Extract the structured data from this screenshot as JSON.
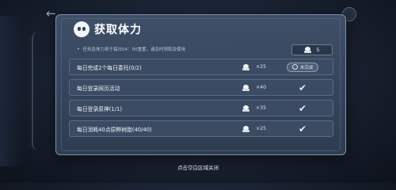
{
  "dialog": {
    "title": "获取体力",
    "notice": "任务及体力将于每日04：00重置，请及时领取及使用",
    "stamina_value": "5"
  },
  "tasks": [
    {
      "label": "每日完成2个每日委托(0/2)",
      "reward": "×25",
      "status": "pending",
      "status_text": "未完成"
    },
    {
      "label": "每日登录网页活动",
      "reward": "×40",
      "status": "done",
      "status_text": ""
    },
    {
      "label": "每日登录原神(1/1)",
      "reward": "×35",
      "status": "done",
      "status_text": ""
    },
    {
      "label": "每日消耗40点原粹树脂(40/40)",
      "reward": "×25",
      "status": "done",
      "status_text": ""
    }
  ],
  "footer": {
    "hint": "点击空白区域关闭"
  },
  "icons": {
    "title": "paimon-icon",
    "stamina": "stamina-icon",
    "done": "checkmark-icon",
    "pending": "clock-icon",
    "back": "back-arrow-icon"
  }
}
